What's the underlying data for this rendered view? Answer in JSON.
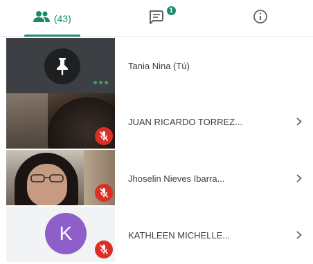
{
  "tabs": {
    "people": {
      "icon": "people-icon",
      "count_label": "(43)"
    },
    "chat": {
      "icon": "chat-icon",
      "badge": "1"
    },
    "info": {
      "icon": "info-icon"
    }
  },
  "participants": [
    {
      "name": "Tania Nina (Tú)",
      "tile": "pinned",
      "icons": [
        "pin-icon",
        "more-dots-icon"
      ],
      "muted": false
    },
    {
      "name": "JUAN RICARDO TORREZ...",
      "tile": "video",
      "muted": true
    },
    {
      "name": "Jhoselin Nieves Ibarra...",
      "tile": "video",
      "muted": true
    },
    {
      "name": "KATHLEEN MICHELLE...",
      "tile": "avatar",
      "avatar_letter": "K",
      "muted": true
    }
  ],
  "colors": {
    "accent": "#1a8a6e",
    "mic_off": "#d93025",
    "avatar_k": "#8e5fc9",
    "dots": "#34a853"
  }
}
